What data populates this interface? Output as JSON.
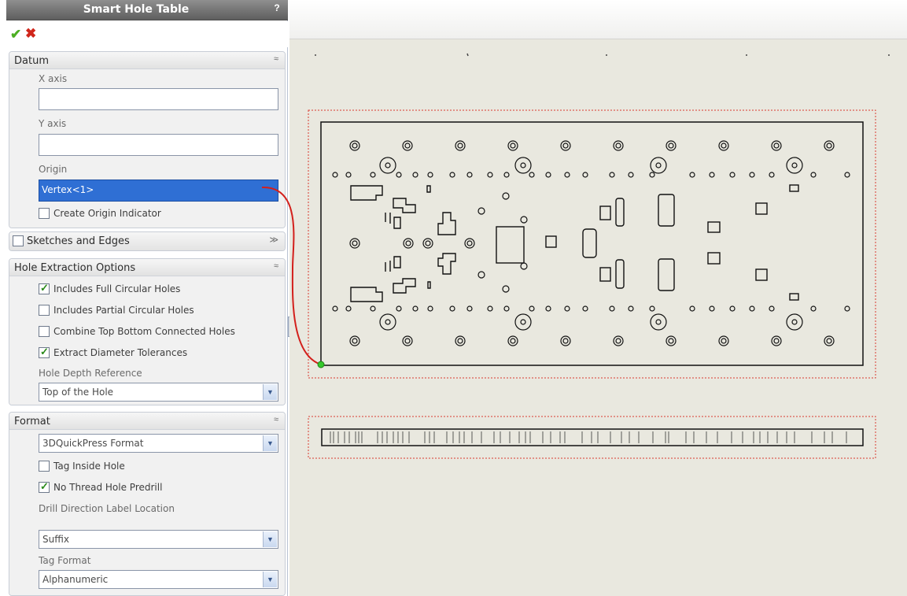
{
  "panel": {
    "title": "Smart Hole Table",
    "help_label": "?",
    "ok_icon": "checkmark-icon",
    "cancel_icon": "x-icon"
  },
  "datum": {
    "title": "Datum",
    "x_axis_label": "X axis",
    "x_axis_value": "",
    "y_axis_label": "Y axis",
    "y_axis_value": "",
    "origin_label": "Origin",
    "origin_value": "Vertex<1>",
    "create_origin_indicator": {
      "label": "Create Origin Indicator",
      "checked": false
    }
  },
  "sketches": {
    "title": "Sketches and Edges",
    "checked": false
  },
  "hole_extraction": {
    "title": "Hole Extraction Options",
    "options": [
      {
        "label": "Includes Full Circular Holes",
        "checked": true
      },
      {
        "label": "Includes Partial Circular Holes",
        "checked": false
      },
      {
        "label": "Combine Top Bottom Connected Holes",
        "checked": false
      },
      {
        "label": "Extract Diameter Tolerances",
        "checked": true
      }
    ],
    "depth_ref_label": "Hole Depth Reference",
    "depth_ref_value": "Top of the Hole"
  },
  "format": {
    "title": "Format",
    "format_value": "3DQuickPress Format",
    "tag_inside": {
      "label": "Tag Inside Hole",
      "checked": false
    },
    "no_thread": {
      "label": "No Thread Hole Predrill",
      "checked": true
    },
    "drill_dir_label": "Drill Direction Label Location",
    "drill_dir_value": "Suffix",
    "tag_format_label": "Tag Format",
    "tag_format_value": "Alphanumeric"
  },
  "colors": {
    "selection": "#2f6fd4",
    "leader": "#d3201c",
    "origin_point": "#35c92c",
    "frame_dash": "#d93a2f"
  }
}
